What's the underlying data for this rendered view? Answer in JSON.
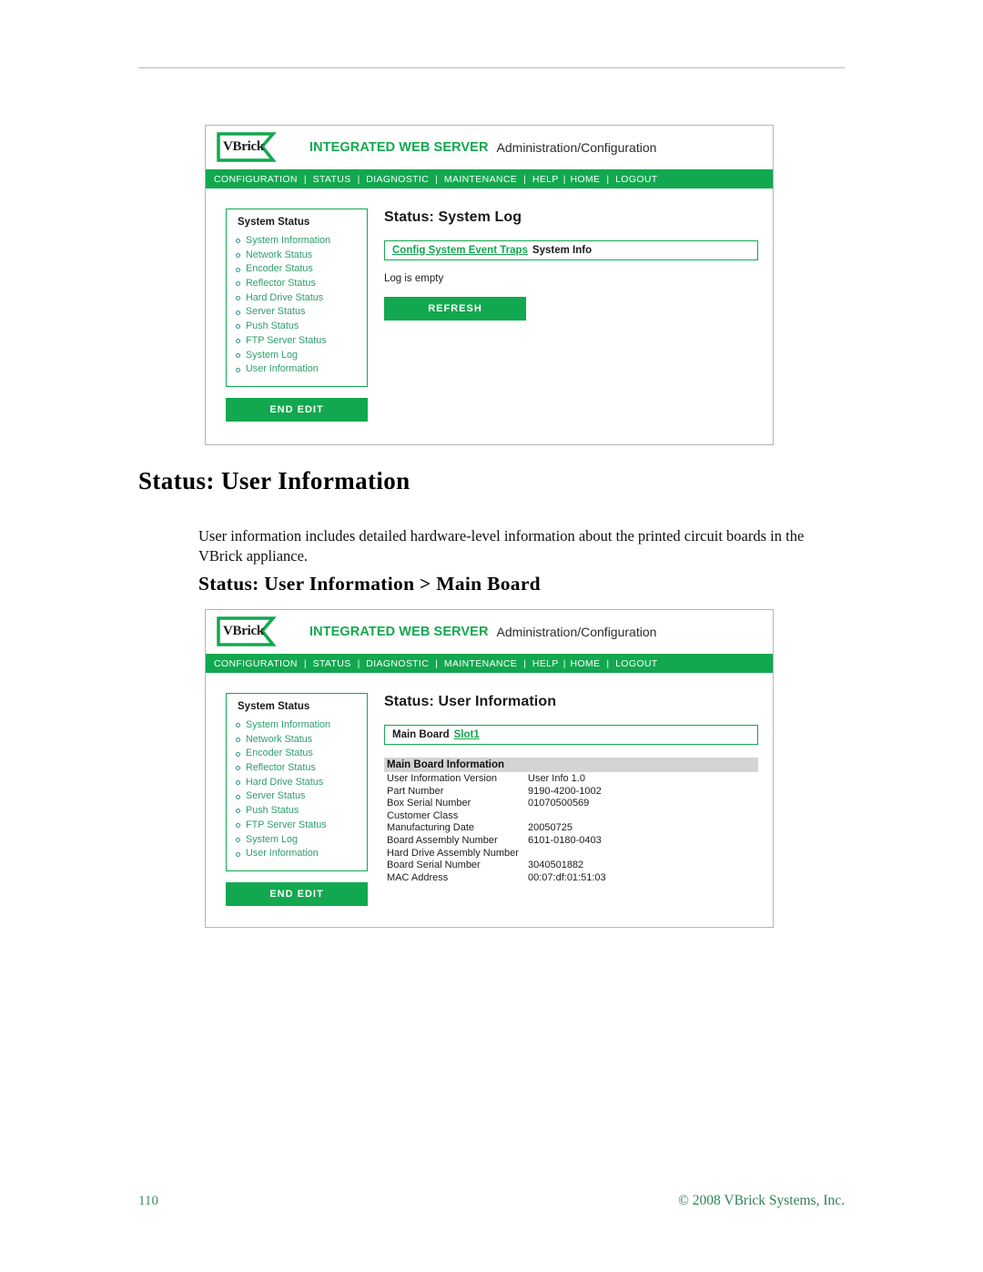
{
  "document": {
    "heading_1": "Status: User Information",
    "paragraph": "User information includes detailed hardware-level information about the printed circuit boards in the VBrick appliance.",
    "heading_2": "Status: User Information > Main Board",
    "footer": {
      "page_number": "110",
      "copyright": "© 2008 VBrick Systems, Inc."
    }
  },
  "colors": {
    "brand_green": "#12a84f",
    "link_green": "#12a84f",
    "sidebar_text": "#2e9e6b",
    "banner_gray": "#d4d4d4",
    "footer_green": "#2e7d55"
  },
  "app_header": {
    "logo_text": "VBrick",
    "product_name": "INTEGRATED WEB SERVER",
    "section_name": "Administration/Configuration"
  },
  "nav": {
    "items": [
      "CONFIGURATION",
      "STATUS",
      "DIAGNOSTIC",
      "MAINTENANCE",
      "HELP",
      "HOME",
      "LOGOUT"
    ],
    "separator": "|"
  },
  "sidebar": {
    "title": "System Status",
    "items": [
      "System Information",
      "Network Status",
      "Encoder Status",
      "Reflector Status",
      "Hard Drive Status",
      "Server Status",
      "Push Status",
      "FTP Server Status",
      "System Log",
      "User Information"
    ],
    "end_edit_label": "END EDIT"
  },
  "screenshot_system_log": {
    "content_title": "Status: System Log",
    "tab_link": "Config System Event Traps",
    "tab_static": "System Info",
    "log_message": "Log is empty",
    "refresh_label": "REFRESH"
  },
  "screenshot_user_info": {
    "content_title": "Status: User Information",
    "tab_static_lead": "Main Board",
    "tab_link": "Slot1",
    "table_banner": "Main Board Information",
    "rows": [
      {
        "label": "User Information Version",
        "value": "User Info 1.0"
      },
      {
        "label": "Part Number",
        "value": "9190-4200-1002"
      },
      {
        "label": "Box Serial Number",
        "value": "01070500569"
      },
      {
        "label": "Customer Class",
        "value": ""
      },
      {
        "label": "Manufacturing Date",
        "value": "20050725"
      },
      {
        "label": "Board Assembly Number",
        "value": "6101-0180-0403"
      },
      {
        "label": "Hard Drive Assembly Number",
        "value": ""
      },
      {
        "label": "Board Serial Number",
        "value": "3040501882"
      },
      {
        "label": "MAC Address",
        "value": "00:07:df:01:51:03"
      }
    ]
  }
}
